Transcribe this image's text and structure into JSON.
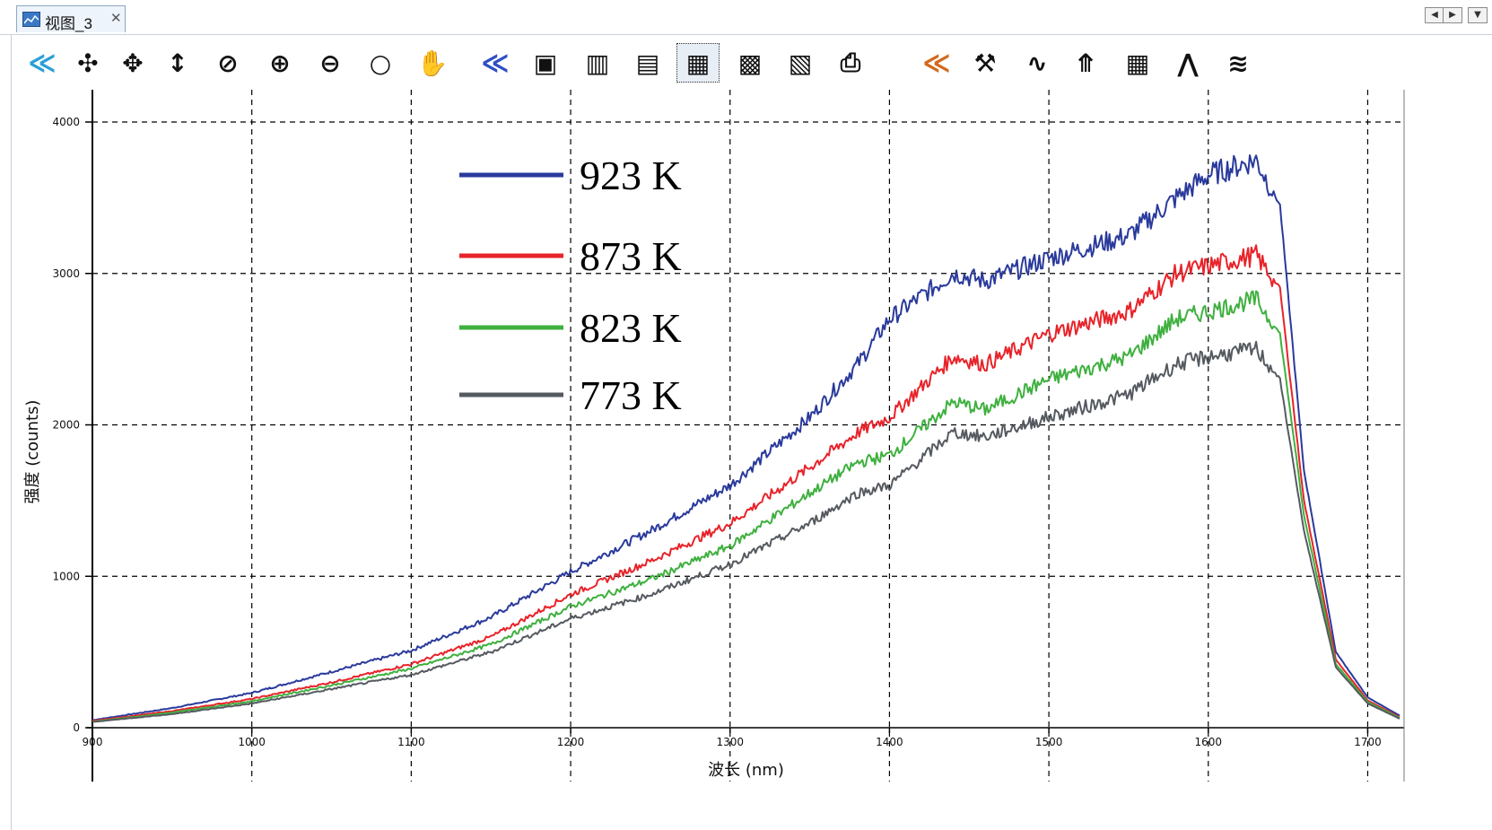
{
  "window": {
    "tab_title": "视图_3",
    "close_glyph": "✕"
  },
  "toolbar": {
    "items": [
      {
        "name": "collapse-icon",
        "glyph": "≪",
        "color": "#2a9fd6"
      },
      {
        "name": "pan-center-icon",
        "glyph": "✣",
        "color": "#111111"
      },
      {
        "name": "move-icon",
        "glyph": "✥",
        "color": "#111111"
      },
      {
        "name": "vertical-resize-icon",
        "glyph": "↕",
        "color": "#111111"
      },
      {
        "name": "zoom-reset-icon",
        "glyph": "⊘",
        "color": "#111111"
      },
      {
        "name": "zoom-in-icon",
        "glyph": "⊕",
        "color": "#111111"
      },
      {
        "name": "zoom-out-icon",
        "glyph": "⊖",
        "color": "#111111"
      },
      {
        "name": "zoom-icon",
        "glyph": "○",
        "color": "#111111"
      },
      {
        "name": "hand-icon",
        "glyph": "✋",
        "color": "#111111"
      },
      {
        "name": "collapse-icon-2",
        "glyph": "≪",
        "color": "#2f4fc4"
      },
      {
        "name": "camera-icon",
        "glyph": "▣",
        "color": "#111111"
      },
      {
        "name": "trash-icon",
        "glyph": "▥",
        "color": "#111111"
      },
      {
        "name": "export-icon",
        "glyph": "▤",
        "color": "#111111"
      },
      {
        "name": "save-as-icon",
        "glyph": "▦",
        "color": "#111111",
        "active": true
      },
      {
        "name": "save-icon",
        "glyph": "▩",
        "color": "#111111"
      },
      {
        "name": "delete-data-icon",
        "glyph": "▧",
        "color": "#111111"
      },
      {
        "name": "print-icon",
        "glyph": "⎙",
        "color": "#111111"
      },
      {
        "name": "collapse-icon-3",
        "glyph": "≪",
        "color": "#d2691e"
      },
      {
        "name": "tools-icon",
        "glyph": "⚒",
        "color": "#111111"
      },
      {
        "name": "waveform-icon",
        "glyph": "∿",
        "color": "#111111"
      },
      {
        "name": "merge-icon",
        "glyph": "⤊",
        "color": "#111111"
      },
      {
        "name": "table-icon",
        "glyph": "▦",
        "color": "#111111"
      },
      {
        "name": "peaks-icon",
        "glyph": "⋀",
        "color": "#111111"
      },
      {
        "name": "noise-icon",
        "glyph": "≋",
        "color": "#111111"
      }
    ]
  },
  "chart_data": {
    "type": "line",
    "title": "",
    "xlabel": "波长 (nm)",
    "ylabel": "强度 (counts)",
    "xlim": [
      900,
      1720
    ],
    "ylim": [
      0,
      4000
    ],
    "x_ticks": [
      900,
      1000,
      1100,
      1200,
      1300,
      1400,
      1500,
      1600,
      1700
    ],
    "y_ticks": [
      0,
      1000,
      2000,
      3000,
      4000
    ],
    "grid": true,
    "legend_position": "top-left",
    "x": [
      900,
      950,
      1000,
      1050,
      1100,
      1150,
      1200,
      1250,
      1300,
      1350,
      1380,
      1400,
      1440,
      1460,
      1500,
      1550,
      1580,
      1600,
      1630,
      1645,
      1660,
      1680,
      1700,
      1720
    ],
    "series": [
      {
        "name": "923 K",
        "color": "#2a3a9c",
        "values": [
          50,
          130,
          230,
          370,
          510,
          730,
          1030,
          1300,
          1600,
          2050,
          2400,
          2700,
          3000,
          2950,
          3100,
          3250,
          3500,
          3650,
          3750,
          3450,
          1700,
          500,
          200,
          80
        ]
      },
      {
        "name": "873 K",
        "color": "#e8232a",
        "values": [
          45,
          110,
          190,
          300,
          420,
          600,
          880,
          1100,
          1350,
          1720,
          1950,
          2050,
          2450,
          2400,
          2600,
          2750,
          3000,
          3050,
          3120,
          2900,
          1500,
          450,
          180,
          70
        ]
      },
      {
        "name": "823 K",
        "color": "#3fb03f",
        "values": [
          40,
          100,
          175,
          280,
          390,
          550,
          800,
          980,
          1200,
          1550,
          1750,
          1800,
          2150,
          2100,
          2300,
          2450,
          2700,
          2750,
          2830,
          2600,
          1400,
          420,
          170,
          65
        ]
      },
      {
        "name": "773 K",
        "color": "#555a60",
        "values": [
          38,
          90,
          160,
          255,
          350,
          500,
          720,
          880,
          1080,
          1350,
          1550,
          1600,
          1950,
          1920,
          2050,
          2200,
          2400,
          2450,
          2500,
          2300,
          1300,
          400,
          160,
          60
        ]
      }
    ]
  }
}
